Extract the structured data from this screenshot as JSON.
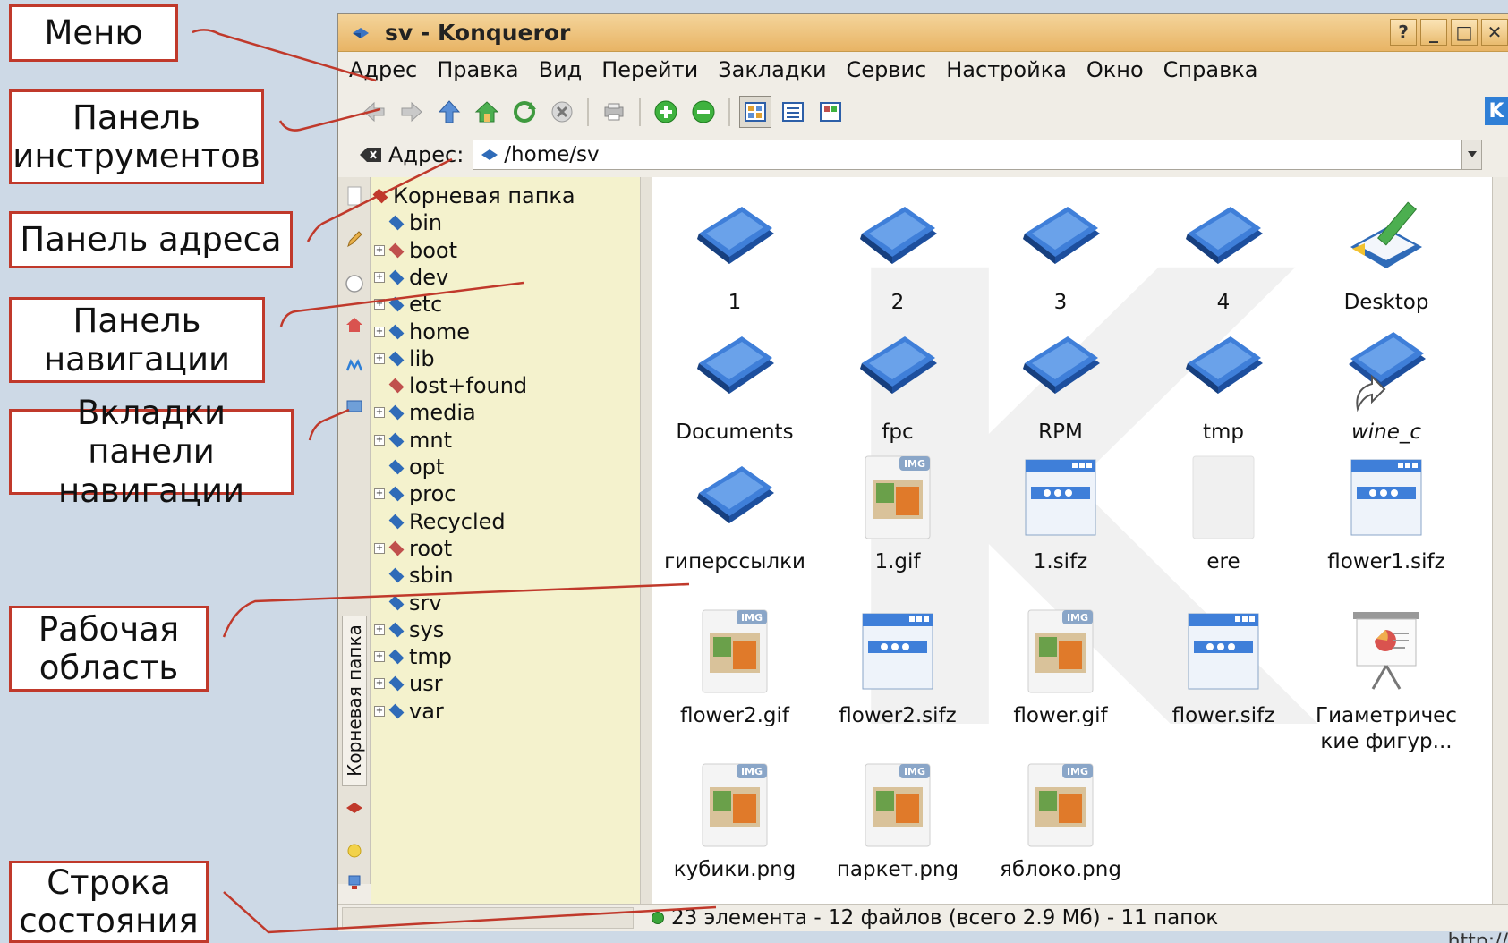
{
  "callouts": {
    "menu": "Меню",
    "toolbar": "Панель инструментов",
    "address_bar": "Панель адреса",
    "nav_panel": "Панель навигации",
    "nav_tabs": "Вкладки панели навигации",
    "workspace": "Рабочая область",
    "statusbar": "Строка состояния"
  },
  "window": {
    "title": "sv - Konqueror",
    "buttons": {
      "help": "?",
      "minimize": "_",
      "maximize": "□",
      "close": "✕"
    }
  },
  "menu": [
    "Адрес",
    "Правка",
    "Вид",
    "Перейти",
    "Закладки",
    "Сервис",
    "Настройка",
    "Окно",
    "Справка"
  ],
  "toolbar_logo": "K",
  "address": {
    "label": "Адрес:",
    "value": "/home/sv"
  },
  "sidebar": {
    "tab_label": "Корневая папка"
  },
  "tree": {
    "root": "Корневая папка",
    "items": [
      {
        "name": "bin",
        "expandable": false,
        "color": "#2f6bb8"
      },
      {
        "name": "boot",
        "expandable": true,
        "color": "#c0504d"
      },
      {
        "name": "dev",
        "expandable": true,
        "color": "#2f6bb8"
      },
      {
        "name": "etc",
        "expandable": true,
        "color": "#2f6bb8"
      },
      {
        "name": "home",
        "expandable": true,
        "color": "#2f6bb8"
      },
      {
        "name": "lib",
        "expandable": true,
        "color": "#2f6bb8"
      },
      {
        "name": "lost+found",
        "expandable": false,
        "color": "#c0504d"
      },
      {
        "name": "media",
        "expandable": true,
        "color": "#2f6bb8"
      },
      {
        "name": "mnt",
        "expandable": true,
        "color": "#2f6bb8"
      },
      {
        "name": "opt",
        "expandable": false,
        "color": "#2f6bb8"
      },
      {
        "name": "proc",
        "expandable": true,
        "color": "#2f6bb8"
      },
      {
        "name": "Recycled",
        "expandable": false,
        "color": "#2f6bb8"
      },
      {
        "name": "root",
        "expandable": true,
        "color": "#c0504d"
      },
      {
        "name": "sbin",
        "expandable": false,
        "color": "#2f6bb8"
      },
      {
        "name": "srv",
        "expandable": false,
        "color": "#2f6bb8"
      },
      {
        "name": "sys",
        "expandable": true,
        "color": "#2f6bb8"
      },
      {
        "name": "tmp",
        "expandable": true,
        "color": "#2f6bb8"
      },
      {
        "name": "usr",
        "expandable": true,
        "color": "#2f6bb8"
      },
      {
        "name": "var",
        "expandable": true,
        "color": "#2f6bb8"
      }
    ]
  },
  "files": [
    {
      "name": "1",
      "icon": "folder-icon"
    },
    {
      "name": "2",
      "icon": "folder-icon"
    },
    {
      "name": "3",
      "icon": "folder-icon"
    },
    {
      "name": "4",
      "icon": "folder-icon"
    },
    {
      "name": "Desktop",
      "icon": "desktop-folder-icon"
    },
    {
      "name": "Documents",
      "icon": "folder-icon"
    },
    {
      "name": "fpc",
      "icon": "folder-icon"
    },
    {
      "name": "RPM",
      "icon": "folder-icon"
    },
    {
      "name": "tmp",
      "icon": "folder-icon"
    },
    {
      "name": "wine_c",
      "icon": "folder-link-icon"
    },
    {
      "name": "гиперссылки",
      "icon": "folder-icon"
    },
    {
      "name": "1.gif",
      "icon": "image-file-icon"
    },
    {
      "name": "1.sifz",
      "icon": "window-file-icon"
    },
    {
      "name": "ere",
      "icon": "blank-file-icon"
    },
    {
      "name": "flower1.sifz",
      "icon": "window-file-icon"
    },
    {
      "name": "flower2.gif",
      "icon": "image-file-icon"
    },
    {
      "name": "flower2.sifz",
      "icon": "window-file-icon"
    },
    {
      "name": "flower.gif",
      "icon": "image-file-icon"
    },
    {
      "name": "flower.sifz",
      "icon": "window-file-icon"
    },
    {
      "name": "Гиаметричес кие фигур...",
      "icon": "presentation-file-icon"
    },
    {
      "name": "кубики.png",
      "icon": "image-file-icon"
    },
    {
      "name": "паркет.png",
      "icon": "image-file-icon"
    },
    {
      "name": "яблоко.png",
      "icon": "image-file-icon"
    }
  ],
  "img_badge": "IMG",
  "status": "23 элемента - 12 файлов (всего 2.9 Мб) - 11 папок",
  "bottom_url": "http://"
}
